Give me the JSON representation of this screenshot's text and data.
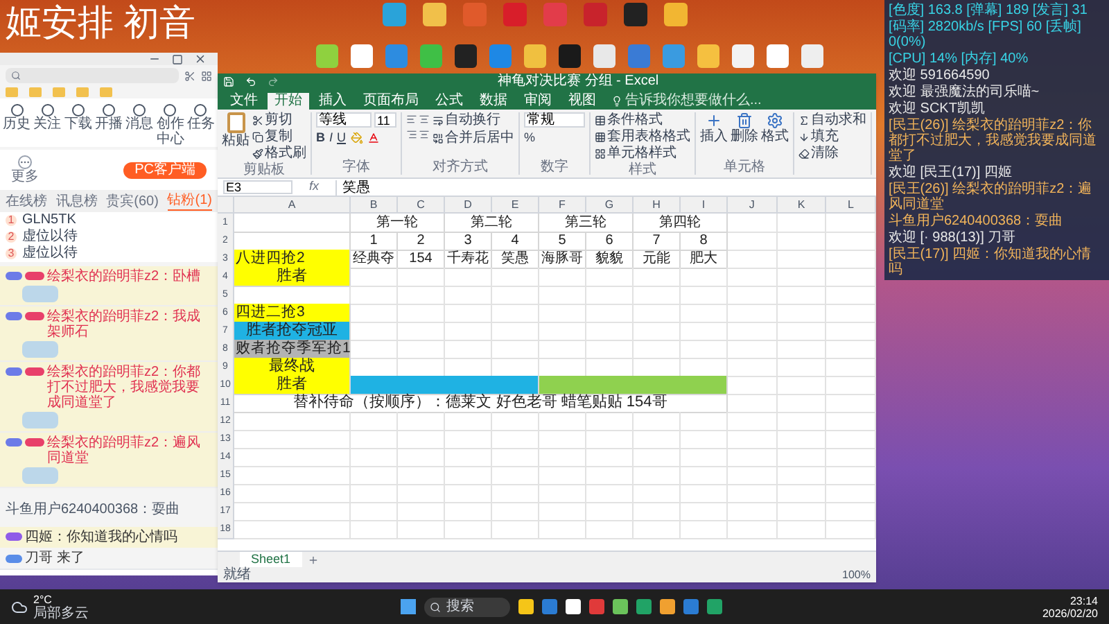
{
  "desktop": {
    "caption": "姬安排 初音"
  },
  "browser": {
    "nav": [
      "历史",
      "关注",
      "下载",
      "开播",
      "消息",
      "创作中心",
      "任务"
    ],
    "more": "更多",
    "client_button": "PC客户端",
    "tabs": [
      {
        "label": "在线榜",
        "selected": false
      },
      {
        "label": "讯息榜",
        "selected": false
      },
      {
        "label": "贵宾(60)",
        "selected": false
      },
      {
        "label": "钻粉(1)",
        "selected": true
      }
    ],
    "ranking": [
      {
        "rank": "1",
        "name": "GLN5TK"
      },
      {
        "rank": "2",
        "name": "虚位以待"
      },
      {
        "rank": "3",
        "name": "虚位以待"
      }
    ],
    "messages": [
      {
        "kind": "sticker",
        "text": "绘梨衣的跆明菲z2：卧槽"
      },
      {
        "kind": "sticker",
        "text": "绘梨衣的跆明菲z2：我成架师石"
      },
      {
        "kind": "sticker",
        "text": "绘梨衣的跆明菲z2：你都打不过肥大，我感觉我要成同道堂了"
      },
      {
        "kind": "sticker",
        "text": "绘梨衣的跆明菲z2：遍风同道堂"
      },
      {
        "kind": "plain",
        "text": "斗鱼用户6240400368：耍曲"
      },
      {
        "kind": "badge",
        "text": "四姬：你知道我的心情吗"
      },
      {
        "kind": "enter",
        "text": "刀哥 来了"
      }
    ]
  },
  "excel": {
    "title": "神龟对决比赛 分组 - Excel",
    "tabs": [
      {
        "label": "文件",
        "selected": false
      },
      {
        "label": "开始",
        "selected": true
      },
      {
        "label": "插入",
        "selected": false
      },
      {
        "label": "页面布局",
        "selected": false
      },
      {
        "label": "公式",
        "selected": false
      },
      {
        "label": "数据",
        "selected": false
      },
      {
        "label": "审阅",
        "selected": false
      },
      {
        "label": "视图",
        "selected": false
      }
    ],
    "tell_me": "告诉我你想要做什么...",
    "ribbon": [
      {
        "kind": "clipboard",
        "label": "剪贴板",
        "items": [
          "粘贴",
          "剪切",
          "复制",
          "格式刷"
        ]
      },
      {
        "kind": "font",
        "label": "字体",
        "font": "等线",
        "size": "11",
        "items": [
          "B",
          "I",
          "U"
        ]
      },
      {
        "kind": "alignment",
        "label": "对齐方式",
        "items": [
          "自动换行",
          "合并后居中"
        ]
      },
      {
        "kind": "number",
        "label": "数字",
        "format": "常规",
        "items": [
          "%"
        ]
      },
      {
        "kind": "styles",
        "label": "样式",
        "items": [
          "条件格式",
          "套用表格格式",
          "单元格样式"
        ]
      },
      {
        "kind": "cells",
        "label": "单元格",
        "items": [
          "插入",
          "删除",
          "格式"
        ]
      },
      {
        "kind": "editing",
        "items": [
          "自动求和",
          "填充",
          "清除"
        ]
      }
    ],
    "name_box": "E3",
    "function_label": "fx",
    "formula": "笑愚",
    "columns": [
      "A",
      "B",
      "C",
      "D",
      "E",
      "F",
      "G",
      "H",
      "I",
      "J",
      "K",
      "L"
    ],
    "rows": [
      {
        "number": "1",
        "kind": "rounds",
        "cells": [
          {
            "kind": "blank"
          },
          {
            "kind": "small",
            "text": "第一轮"
          },
          {
            "kind": "small",
            "text": "第二轮"
          },
          {
            "kind": "small",
            "text": "第三轮"
          },
          {
            "kind": "small",
            "text": "第四轮"
          }
        ]
      },
      {
        "number": "2",
        "kind": "numbers",
        "cells": [
          {
            "kind": "blank"
          },
          {
            "kind": "small",
            "text": "1"
          },
          {
            "kind": "small",
            "text": "2"
          },
          {
            "kind": "small",
            "text": "3"
          },
          {
            "kind": "small",
            "text": "4"
          },
          {
            "kind": "small",
            "text": "5"
          },
          {
            "kind": "small",
            "text": "6"
          },
          {
            "kind": "small",
            "text": "7"
          },
          {
            "kind": "small",
            "text": "8"
          }
        ]
      },
      {
        "number": "3",
        "cells": [
          {
            "kind": "left",
            "text": "八进四抢2",
            "color": "#ffff00"
          },
          {
            "kind": "small",
            "text": "经典夺"
          },
          {
            "kind": "small",
            "text": "154"
          },
          {
            "kind": "small",
            "text": "千寿花"
          },
          {
            "kind": "small",
            "text": "笑愚"
          },
          {
            "kind": "small",
            "text": "海豚哥"
          },
          {
            "kind": "small",
            "text": "貌貌"
          },
          {
            "kind": "small",
            "text": "元能"
          },
          {
            "kind": "small",
            "text": "肥大"
          }
        ]
      },
      {
        "number": "4",
        "cells": [
          {
            "kind": "center",
            "text": "胜者",
            "color": "#ffff00"
          }
        ]
      },
      {
        "number": "5",
        "cells": []
      },
      {
        "number": "6",
        "cells": [
          {
            "kind": "left",
            "text": "四进二抢3",
            "color": "#ffff00"
          }
        ]
      },
      {
        "number": "7",
        "cells": [
          {
            "kind": "center",
            "text": "胜者抢夺冠亚",
            "color": "#1fb2e3"
          }
        ]
      },
      {
        "number": "8",
        "cells": [
          {
            "kind": "left",
            "text": "败者抢夺季军抢1",
            "color": "#b3b3b3"
          }
        ]
      },
      {
        "number": "9",
        "cells": [
          {
            "kind": "center",
            "text": "最终战",
            "color": "#ffff00"
          }
        ]
      },
      {
        "number": "10",
        "kind": "halves",
        "cells": [
          {
            "kind": "center",
            "text": "胜者",
            "color": "#ffff00"
          },
          {
            "color": "#1fb2e3"
          },
          {
            "color": "#8fd14f"
          }
        ]
      },
      {
        "number": "11",
        "kind": "summary",
        "cells": [
          {
            "kind": "center",
            "text": "替补待命（按顺序）：德莱文 好色老哥 蜡笔贴贴 154哥"
          }
        ]
      },
      {
        "number": "12",
        "cells": []
      },
      {
        "number": "13",
        "cells": []
      },
      {
        "number": "14",
        "cells": []
      },
      {
        "number": "15",
        "cells": []
      },
      {
        "number": "16",
        "cells": []
      },
      {
        "number": "17",
        "cells": []
      },
      {
        "number": "18",
        "cells": []
      }
    ],
    "sheet_tab": "Sheet1",
    "status": "就绪",
    "zoom": "100%"
  },
  "overlay": [
    {
      "kind": "stat",
      "text": "[色度] 163.8 [弹幕] 189 [发言] 31"
    },
    {
      "kind": "stat",
      "text": "[码率] 2820kb/s [FPS] 60 [丢帧] 0(0%)"
    },
    {
      "kind": "stat",
      "text": "[CPU] 14% [内存] 40%"
    },
    {
      "kind": "welcome",
      "text": "欢迎 591664590"
    },
    {
      "kind": "welcome",
      "text": "欢迎 最强魔法的司乐喵~"
    },
    {
      "kind": "welcome",
      "text": "欢迎 SCKT凯凯"
    },
    {
      "kind": "chat",
      "text": "[民王(26)] 绘梨衣的跆明菲z2：你都打不过肥大，我感觉我要成同道堂了"
    },
    {
      "kind": "welcome",
      "text": "欢迎 [民王(17)] 四姬"
    },
    {
      "kind": "chat",
      "text": "[民王(26)] 绘梨衣的跆明菲z2：遍风同道堂"
    },
    {
      "kind": "chat",
      "text": "斗鱼用户6240400368：耍曲"
    },
    {
      "kind": "welcome",
      "text": "欢迎 [· 988(13)] 刀哥"
    },
    {
      "kind": "chat",
      "text": "[民王(17)] 四姬：你知道我的心情吗"
    }
  ],
  "taskbar": {
    "temperature": "2°C",
    "weather": "局部多云",
    "search_placeholder": "搜索",
    "time": "23:14",
    "date": "2026/02/20"
  }
}
